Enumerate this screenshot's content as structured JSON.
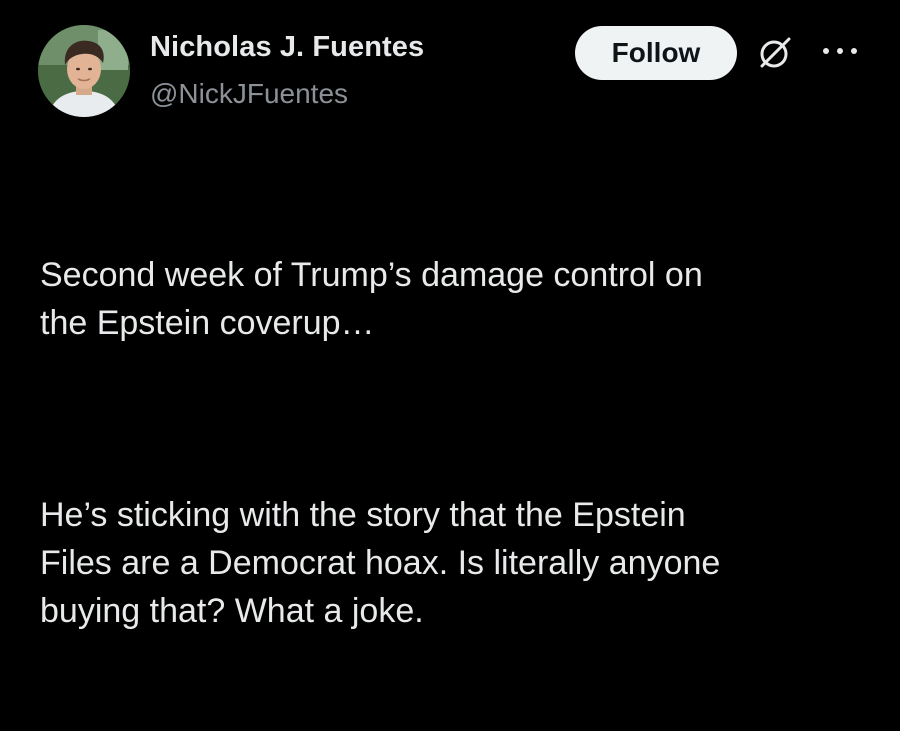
{
  "tweet": {
    "author": {
      "display_name": "Nicholas J. Fuentes",
      "handle": "@NickJFuentes",
      "avatar_icon": "profile-photo"
    },
    "actions": {
      "follow_label": "Follow",
      "grok_icon": "grok-icon",
      "more_icon": "more-dots-icon"
    },
    "body": {
      "paragraph_1": "Second week of Trump’s damage control on\nthe Epstein coverup…",
      "paragraph_2": "He’s sticking with the story that the Epstein\nFiles are a Democrat hoax. Is literally anyone\nbuying that? What a joke."
    }
  },
  "colors": {
    "background": "#000000",
    "text_primary": "#e7e9ea",
    "text_secondary": "#8b9196",
    "follow_button_bg": "#eff3f4",
    "follow_button_text": "#0f1419"
  }
}
